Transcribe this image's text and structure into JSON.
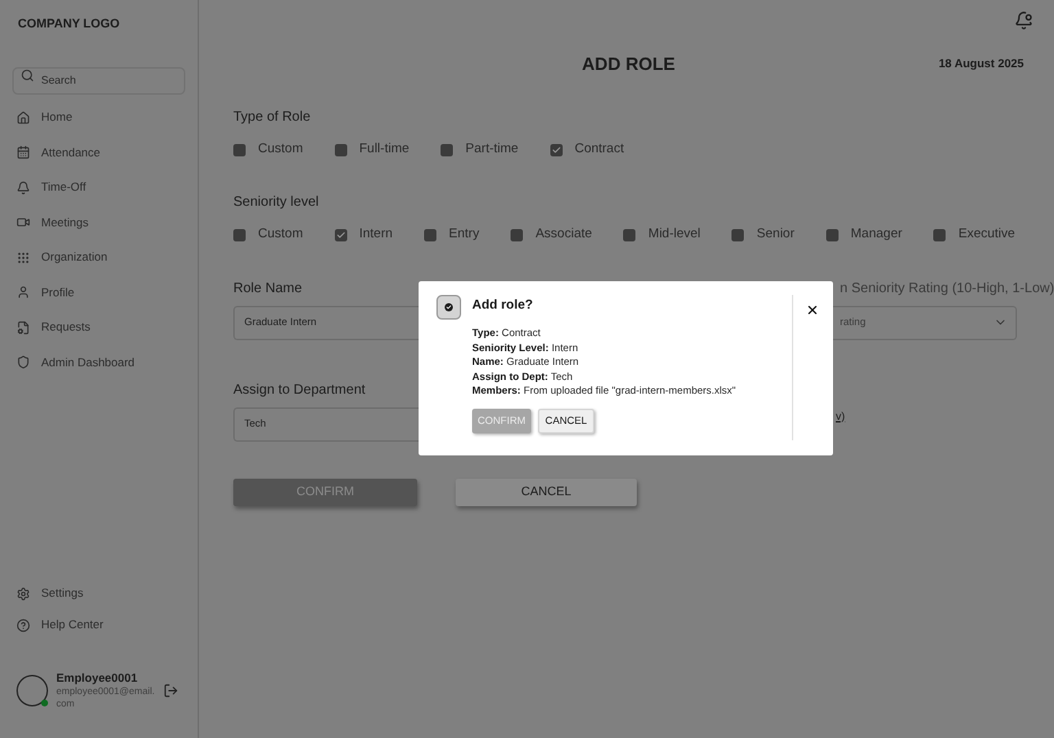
{
  "logo": "COMPANY LOGO",
  "search": {
    "placeholder": "Search"
  },
  "nav": [
    {
      "label": "Home"
    },
    {
      "label": "Attendance"
    },
    {
      "label": "Time-Off"
    },
    {
      "label": "Meetings"
    },
    {
      "label": "Organization"
    },
    {
      "label": "Profile"
    },
    {
      "label": "Requests"
    },
    {
      "label": "Admin Dashboard"
    }
  ],
  "footer_nav": [
    {
      "label": "Settings"
    },
    {
      "label": "Help Center"
    }
  ],
  "user": {
    "name": "Employee0001",
    "email": "employee0001@email.com",
    "online": true
  },
  "title": "ADD ROLE",
  "date": "18 August 2025",
  "role_type": {
    "label": "Type of Role",
    "options": [
      {
        "label": "Custom",
        "checked": false
      },
      {
        "label": "Full-time",
        "checked": false
      },
      {
        "label": "Part-time",
        "checked": false
      },
      {
        "label": "Contract",
        "checked": true
      }
    ]
  },
  "seniority": {
    "label": "Seniority level",
    "options": [
      {
        "label": "Custom",
        "checked": false
      },
      {
        "label": "Intern",
        "checked": true
      },
      {
        "label": "Entry",
        "checked": false
      },
      {
        "label": "Associate",
        "checked": false
      },
      {
        "label": "Mid-level",
        "checked": false
      },
      {
        "label": "Senior",
        "checked": false
      },
      {
        "label": "Manager",
        "checked": false
      },
      {
        "label": "Executive",
        "checked": false
      }
    ]
  },
  "role_name": {
    "label": "Role Name",
    "value": "Graduate Intern"
  },
  "rating": {
    "label": "n Seniority Rating (10-High, 1-Low)",
    "placeholder": "rating"
  },
  "department": {
    "label": "Assign to Department",
    "value": "Tech"
  },
  "upload_link": "v)",
  "buttons": {
    "confirm": "CONFIRM",
    "cancel": "CANCEL"
  },
  "modal": {
    "title": "Add role?",
    "lines": [
      {
        "label": "Type:",
        "value": "Contract"
      },
      {
        "label": "Seniority Level:",
        "value": "Intern"
      },
      {
        "label": "Name:",
        "value": "Graduate Intern"
      },
      {
        "label": "Assign to Dept:",
        "value": "Tech"
      },
      {
        "label": "Members:",
        "value": "From uploaded file \"grad-intern-members.xlsx\""
      }
    ],
    "confirm": "CONFIRM",
    "cancel": "CANCEL"
  }
}
